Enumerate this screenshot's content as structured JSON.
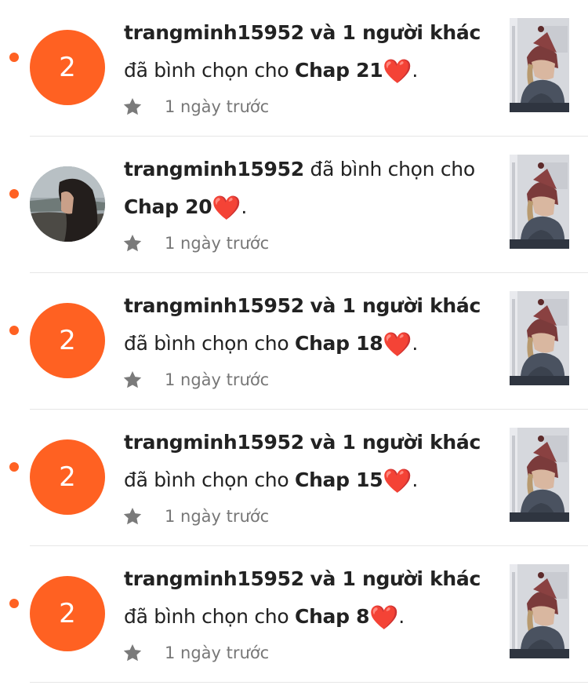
{
  "notifications": [
    {
      "avatar": {
        "type": "count",
        "text": "2"
      },
      "user": "trangminh15952",
      "others": "và 1 người khác",
      "verb": "đã bình chọn cho",
      "chapter": "Chap 21",
      "heart": "❤️",
      "end": ".",
      "time": "1 ngày trước"
    },
    {
      "avatar": {
        "type": "photo",
        "text": ""
      },
      "user": "trangminh15952",
      "others": "",
      "verb": "đã bình chọn cho",
      "chapter": "Chap 20",
      "heart": "❤️",
      "end": ".",
      "time": "1 ngày trước"
    },
    {
      "avatar": {
        "type": "count",
        "text": "2"
      },
      "user": "trangminh15952",
      "others": "và 1 người khác",
      "verb": "đã bình chọn cho",
      "chapter": "Chap 18",
      "heart": "❤️",
      "end": ".",
      "time": "1 ngày trước"
    },
    {
      "avatar": {
        "type": "count",
        "text": "2"
      },
      "user": "trangminh15952",
      "others": "và 1 người khác",
      "verb": "đã bình chọn cho",
      "chapter": "Chap 15",
      "heart": "❤️",
      "end": ".",
      "time": "1 ngày trước"
    },
    {
      "avatar": {
        "type": "count",
        "text": "2"
      },
      "user": "trangminh15952",
      "others": "và 1 người khác",
      "verb": "đã bình chọn cho",
      "chapter": "Chap 8",
      "heart": "❤️",
      "end": ".",
      "time": "1 ngày trước"
    }
  ],
  "icons": {
    "unread": "unread-dot-icon",
    "vote": "star-icon"
  },
  "colors": {
    "accent": "#ff6122",
    "text": "#222222",
    "muted": "#777777",
    "divider": "#e6e6e6"
  }
}
